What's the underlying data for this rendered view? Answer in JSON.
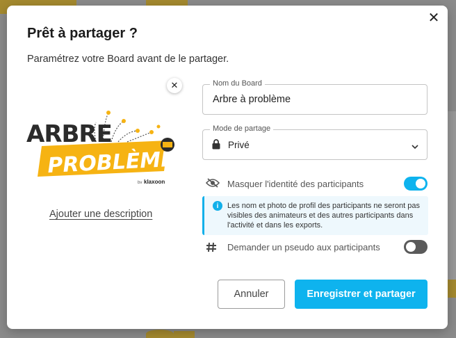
{
  "dialog": {
    "title": "Prêt à partager ?",
    "subtitle": "Paramétrez votre Board avant de le partager.",
    "close_icon": "close-icon",
    "logo": {
      "line1": "ARBRE",
      "line2": "PROBLÈME",
      "by": "by",
      "brand": "klaxoon",
      "remove_icon": "close-icon"
    },
    "add_description": "Ajouter une description",
    "board_name": {
      "label": "Nom du Board",
      "value": "Arbre à problème"
    },
    "share_mode": {
      "label": "Mode de partage",
      "value": "Privé",
      "icon": "lock-icon"
    },
    "hide_identity": {
      "label": "Masquer l'identité des participants",
      "icon": "eye-off-icon",
      "enabled": true
    },
    "info": {
      "text": "Les nom et photo de profil des participants ne seront pas visibles des animateurs et des autres participants dans l'activité et dans les exports."
    },
    "ask_pseudo": {
      "label": "Demander un pseudo aux participants",
      "icon": "hash-icon",
      "enabled": false
    },
    "buttons": {
      "cancel": "Annuler",
      "submit": "Enregistrer et partager"
    }
  },
  "colors": {
    "accent": "#0eb3ee",
    "logo_yellow": "#f6b313",
    "overlay": "#8e8e8e"
  }
}
